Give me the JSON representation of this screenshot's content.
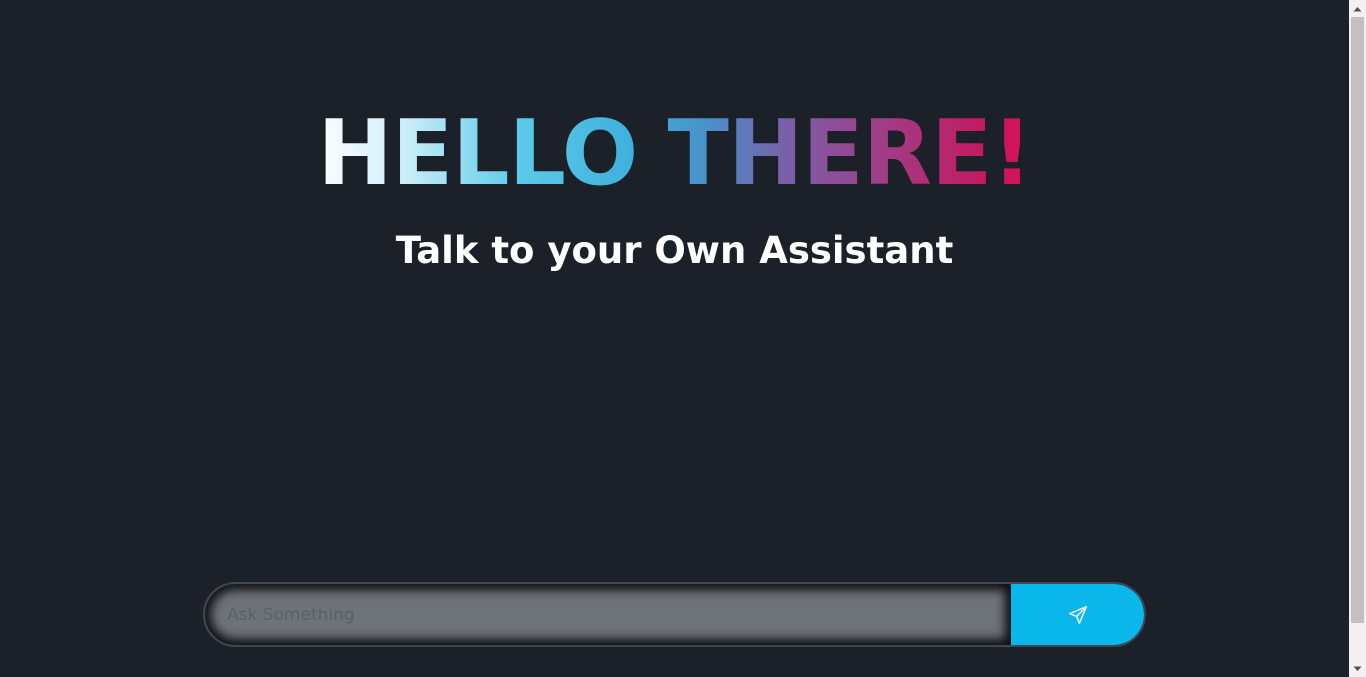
{
  "hero": {
    "title": "HELLO THERE!"
  },
  "subtitle": "Talk to your Own Assistant",
  "composer": {
    "placeholder": "Ask Something",
    "send_icon": "send-icon"
  },
  "colors": {
    "background": "#1c2028",
    "accent": "#0ab7ea",
    "gradient_start": "#ffffff",
    "gradient_mid": "#3daedc",
    "gradient_end": "#d9145a"
  }
}
